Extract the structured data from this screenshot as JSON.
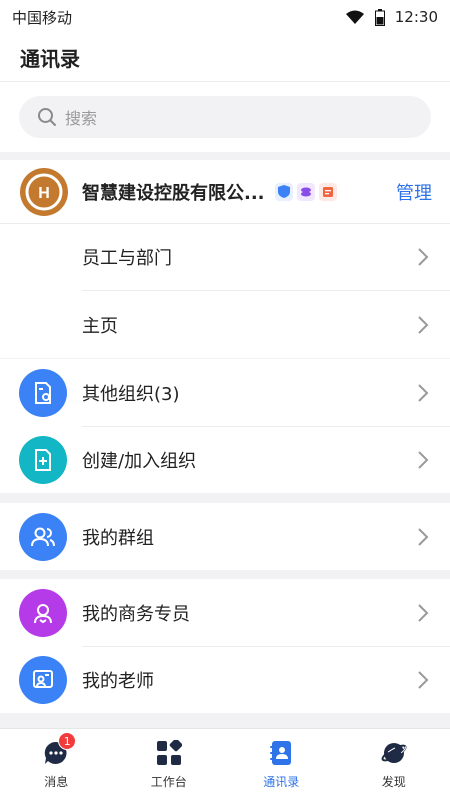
{
  "status": {
    "carrier": "中国移动",
    "time": "12:30"
  },
  "header": {
    "title": "通讯录"
  },
  "search": {
    "placeholder": "搜索"
  },
  "org": {
    "name": "智慧建设控股有限公...",
    "manage": "管理",
    "items": [
      {
        "label": "员工与部门"
      },
      {
        "label": "主页"
      }
    ]
  },
  "list1": [
    {
      "label": "其他组织(3)",
      "icon": "org-list-icon",
      "color": "#3a82f6"
    },
    {
      "label": "创建/加入组织",
      "icon": "add-org-icon",
      "color": "#12b6c5"
    }
  ],
  "list2": [
    {
      "label": "我的群组",
      "icon": "group-icon",
      "color": "#3a82f6"
    }
  ],
  "list3": [
    {
      "label": "我的商务专员",
      "icon": "service-icon",
      "color": "#b63be8"
    },
    {
      "label": "我的老师",
      "icon": "teacher-icon",
      "color": "#3a82f6"
    }
  ],
  "tabbar": {
    "tabs": [
      {
        "label": "消息",
        "badge": "1"
      },
      {
        "label": "工作台"
      },
      {
        "label": "通讯录"
      },
      {
        "label": "发现"
      }
    ]
  },
  "colors": {
    "accent": "#2f73e8",
    "badge": "#f23b3b"
  }
}
